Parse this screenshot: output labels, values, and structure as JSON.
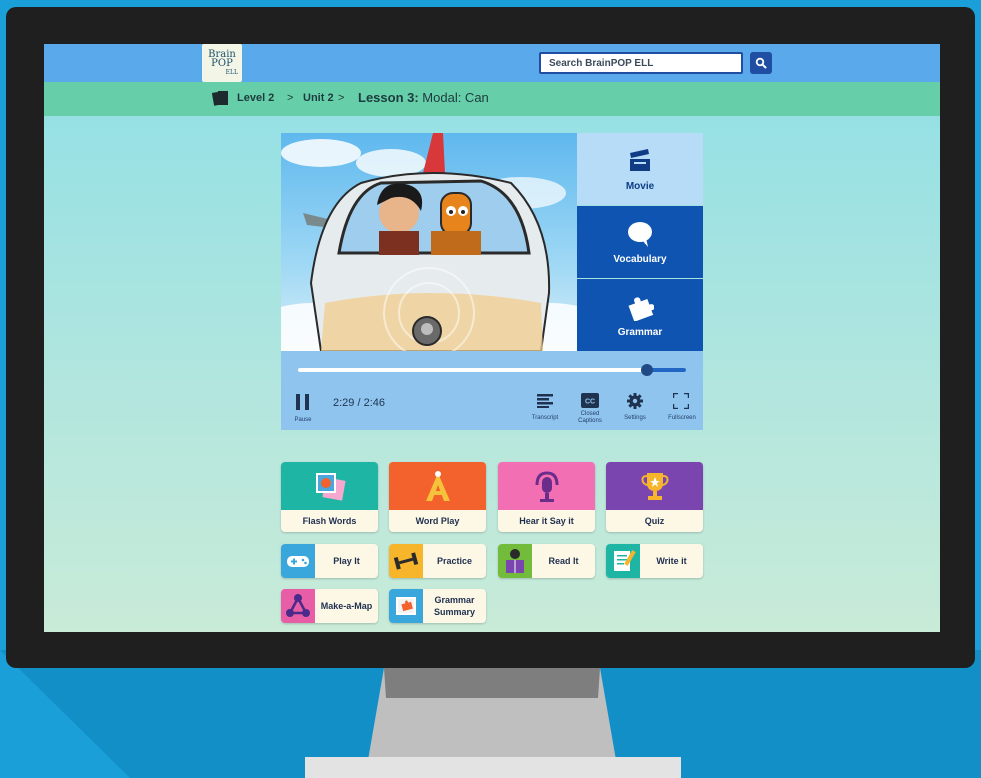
{
  "app": {
    "logo_text_line1": "Brain",
    "logo_text_line2": "POP",
    "logo_text_line3": "ELL",
    "search_placeholder": "Search BrainPOP ELL"
  },
  "breadcrumb": {
    "level": "Level 2",
    "separator1": ">",
    "unit": "Unit 2",
    "separator2": ">",
    "lesson_bold": "Lesson 3:",
    "lesson_rest": " Modal: Can"
  },
  "player": {
    "tabs": [
      {
        "label": "Movie",
        "icon": "clapperboard-icon",
        "active": true
      },
      {
        "label": "Vocabulary",
        "icon": "speech-bubble-icon",
        "active": false
      },
      {
        "label": "Grammar",
        "icon": "puzzle-icon",
        "active": false
      }
    ],
    "time": "2:29 / 2:46",
    "progress": 0.9,
    "controls": {
      "pause": "Pause",
      "transcript": "Transcript",
      "closed_captions_line1": "Closed",
      "closed_captions_line2": "Captions",
      "settings": "Settings",
      "fullscreen": "Fullscreen"
    }
  },
  "activities": {
    "big": [
      {
        "label": "Flash Words",
        "color": "#1fb5a5"
      },
      {
        "label": "Word Play",
        "color": "#f3612c"
      },
      {
        "label": "Hear it Say it",
        "color": "#f36fb4"
      },
      {
        "label": "Quiz",
        "color": "#7b45b0"
      }
    ],
    "small": [
      {
        "label": "Play It",
        "color": "#3aa7dc"
      },
      {
        "label": "Practice",
        "color": "#f6b52b"
      },
      {
        "label": "Read It",
        "color": "#73bb3a"
      },
      {
        "label": "Write it",
        "color": "#1fb5a5"
      },
      {
        "label": "Make-a-Map",
        "color": "#e85ea6"
      },
      {
        "label": "Grammar Summary",
        "label_line1": "Grammar",
        "label_line2": "Summary",
        "color": "#3aa7dc"
      }
    ]
  }
}
